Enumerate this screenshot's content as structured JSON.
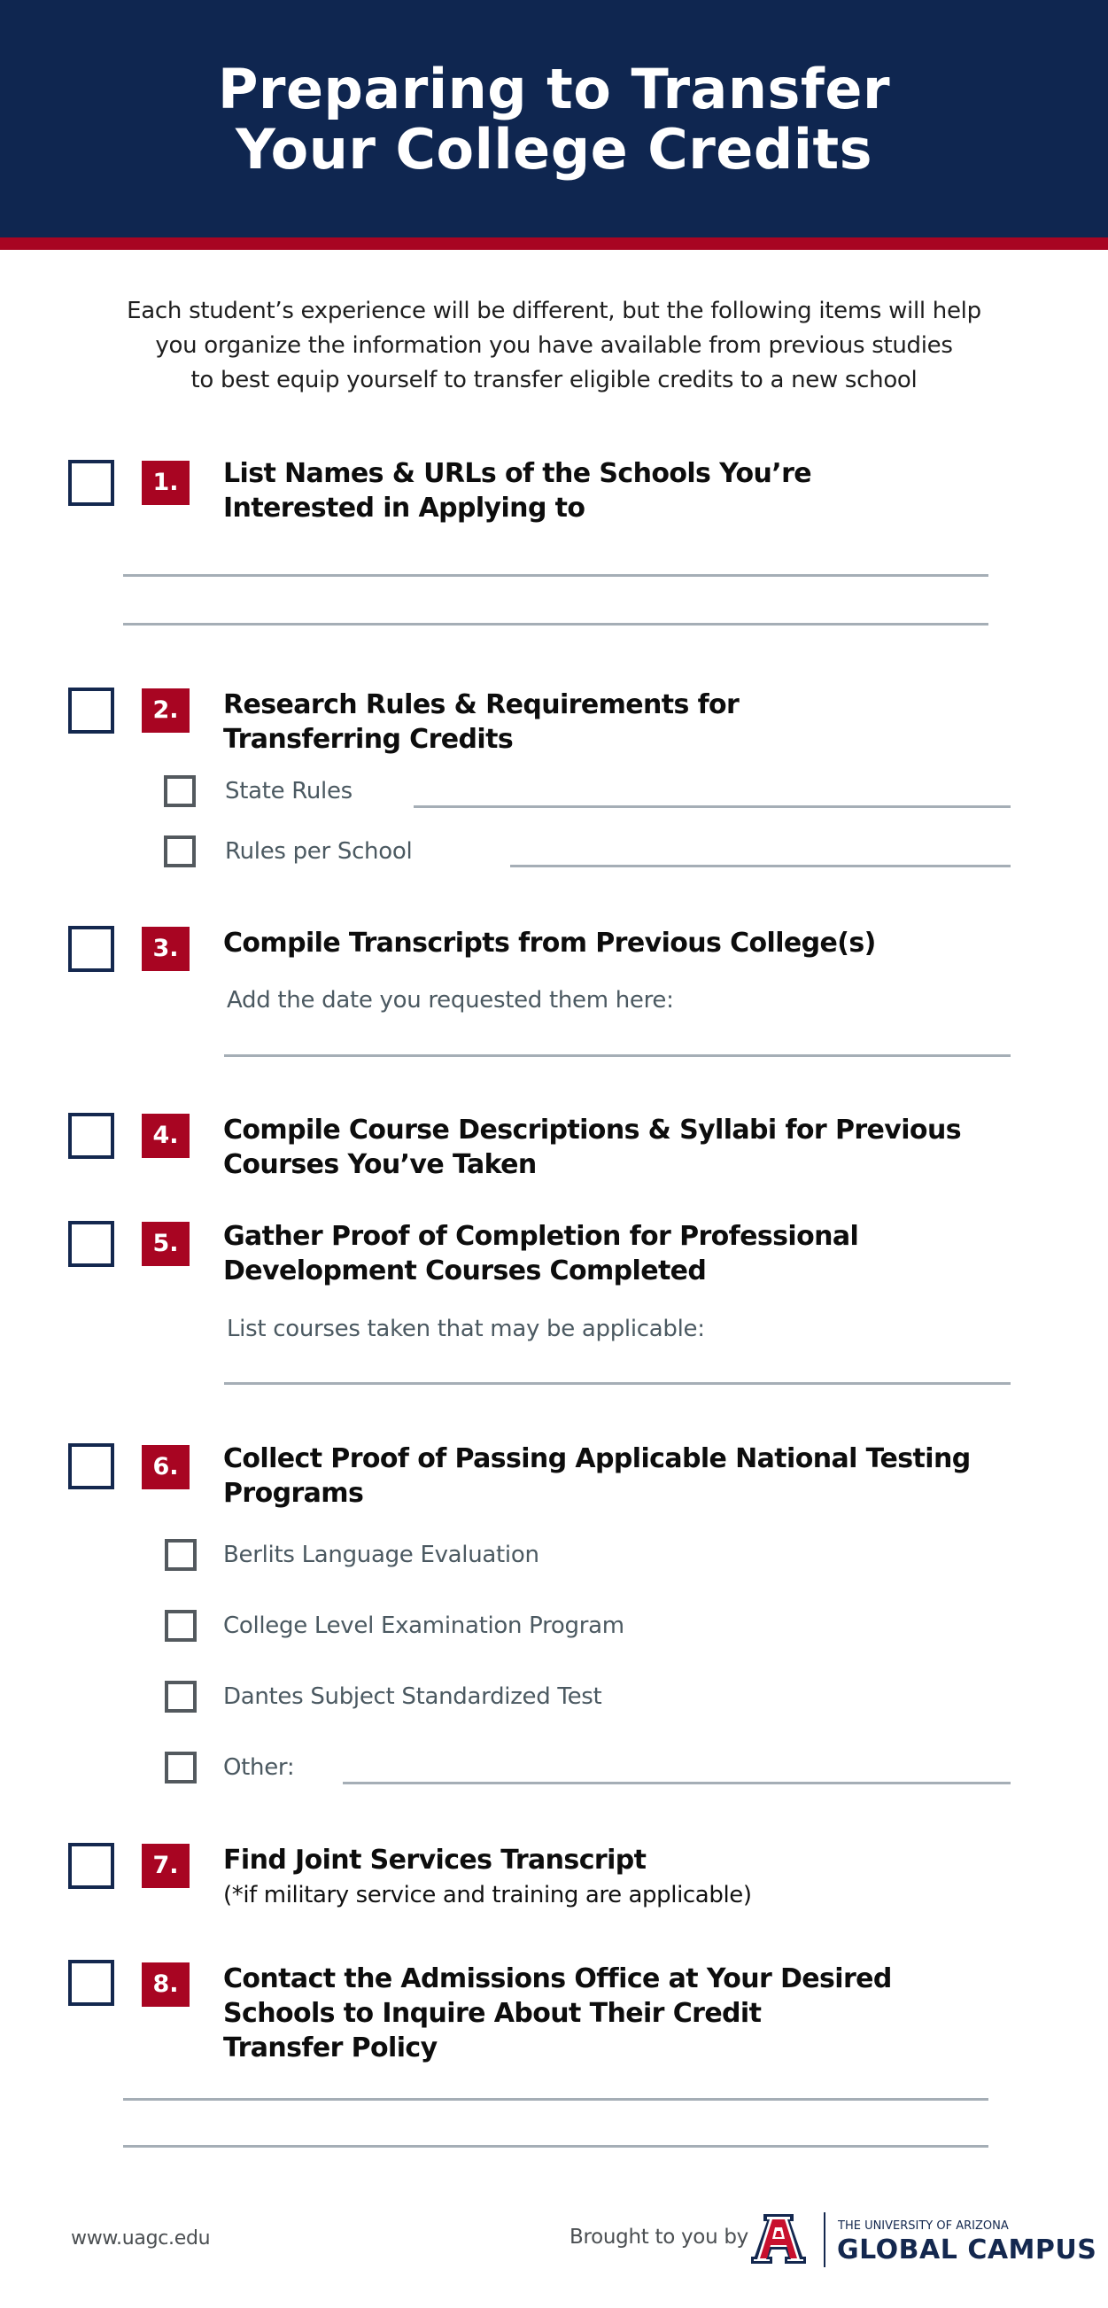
{
  "header": {
    "title_lines": [
      "Preparing to Transfer",
      "Your College Credits"
    ]
  },
  "intro": {
    "lines": [
      "Each student’s experience will be different, but the following items will help",
      "you organize the information you have available from previous studies",
      "to best equip yourself to transfer eligible credits to a new school"
    ]
  },
  "colors": {
    "navy": "#0f2650",
    "red": "#a80522",
    "line_gray": "#a5aeb6",
    "sub_text": "#4b5961"
  },
  "items": [
    {
      "number": "1.",
      "title_lines": [
        "List Names & URLs of the Schools You’re",
        "Interested in Applying to"
      ],
      "checked": false
    },
    {
      "number": "2.",
      "title_lines": [
        "Research Rules & Requirements for",
        "Transferring Credits"
      ],
      "checked": false,
      "subitems": [
        {
          "label": "State Rules",
          "checked": false
        },
        {
          "label": "Rules per School",
          "checked": false
        }
      ]
    },
    {
      "number": "3.",
      "title_lines": [
        "Compile Transcripts from Previous College(s)"
      ],
      "checked": false,
      "prompt": "Add the date you requested them here:"
    },
    {
      "number": "4.",
      "title_lines": [
        "Compile Course Descriptions & Syllabi for Previous",
        "Courses You’ve Taken"
      ],
      "checked": false
    },
    {
      "number": "5.",
      "title_lines": [
        "Gather Proof of Completion for Professional",
        "Development Courses Completed"
      ],
      "checked": false,
      "prompt": "List courses taken that may be applicable:"
    },
    {
      "number": "6.",
      "title_lines": [
        "Collect Proof of Passing Applicable National Testing",
        "Programs"
      ],
      "checked": false,
      "subitems": [
        {
          "label": "Berlits Language Evaluation",
          "checked": false
        },
        {
          "label": "College Level Examination Program",
          "checked": false
        },
        {
          "label": "Dantes Subject Standardized Test",
          "checked": false
        },
        {
          "label": "Other:",
          "checked": false
        }
      ]
    },
    {
      "number": "7.",
      "title_lines": [
        "Find Joint Services Transcript"
      ],
      "note": "(*if military service and training are applicable)",
      "checked": false
    },
    {
      "number": "8.",
      "title_lines": [
        "Contact the Admissions Office at Your Desired",
        "Schools to Inquire About Their Credit",
        "Transfer Policy"
      ],
      "checked": false
    }
  ],
  "footer": {
    "url": "www.uagc.edu",
    "brought_by": "Brought to you by",
    "logo": {
      "icon": "block-a-logo-icon",
      "university": "THE UNIVERSITY OF ARIZONA",
      "campus": "GLOBAL CAMPUS"
    }
  }
}
